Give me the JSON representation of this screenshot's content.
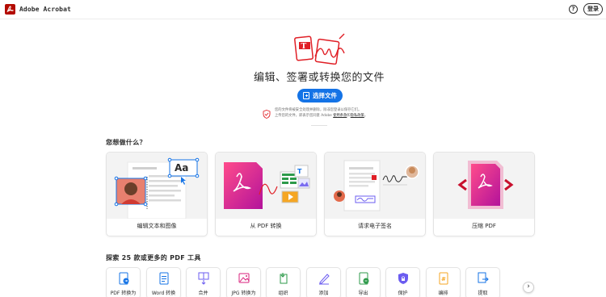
{
  "header": {
    "app_name": "Adobe Acrobat",
    "help_icon": "question-circle-icon",
    "login_label": "登录"
  },
  "hero": {
    "title": "编辑、签署或转换您的文件",
    "select_button": "选择文件",
    "privacy_line1": "您的文件将被安全处理并删除，除非您登录以保存它们。",
    "privacy_line2_prefix": "上传您的文件，即表示您同意 Adobe ",
    "privacy_terms": "使用条款",
    "privacy_and": "和",
    "privacy_policy": "隐私政策",
    "privacy_end": "。"
  },
  "tasks": {
    "title": "您想做什么？",
    "cards": [
      {
        "label": "编辑文本和图像"
      },
      {
        "label": "从 PDF 转换"
      },
      {
        "label": "请求电子签名"
      },
      {
        "label": "压缩 PDF"
      }
    ],
    "edit_text_sample": "Aa"
  },
  "tools": {
    "title": "探索 25 款或更多的 PDF 工具",
    "items": [
      {
        "label": "PDF 转换为",
        "icon": "pdf-convert-icon"
      },
      {
        "label": "Word 转换",
        "icon": "word-convert-icon"
      },
      {
        "label": "合并",
        "icon": "merge-icon"
      },
      {
        "label": "JPG 转换为",
        "icon": "jpg-convert-icon"
      },
      {
        "label": "组织",
        "icon": "organize-icon"
      },
      {
        "label": "添加",
        "icon": "add-sign-icon"
      },
      {
        "label": "导出",
        "icon": "export-icon"
      },
      {
        "label": "保护",
        "icon": "protect-icon"
      },
      {
        "label": "编排",
        "icon": "number-pages-icon"
      },
      {
        "label": "提取",
        "icon": "extract-icon"
      }
    ],
    "next_icon": "chevron-right-icon"
  },
  "colors": {
    "accent": "#1473e6",
    "brand_red": "#e01f26",
    "dark_red": "#b30b00"
  }
}
